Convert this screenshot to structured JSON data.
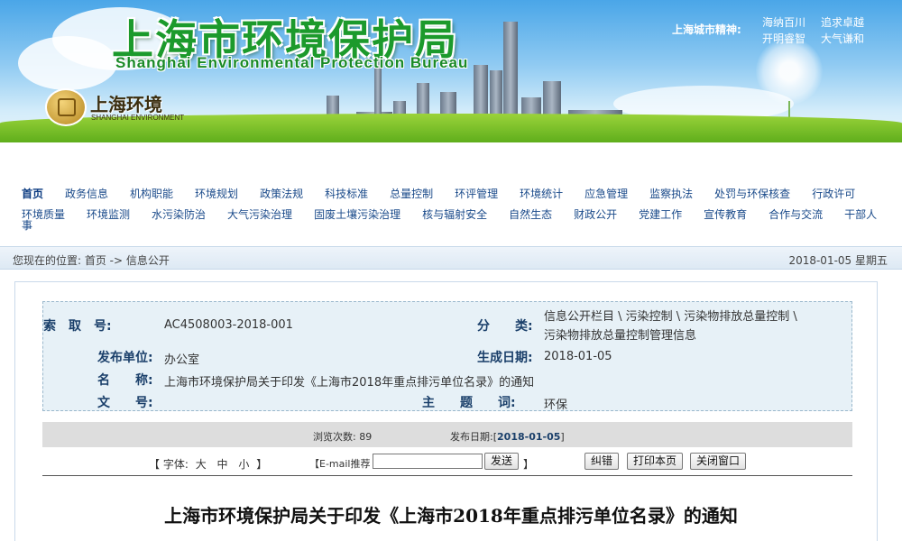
{
  "header": {
    "title_cn": "上海市环境保护局",
    "title_en": "Shanghai Environmental Protection Bureau",
    "logo_cn": "上海环境",
    "logo_en": "SHANGHAI ENVIRONMENT",
    "spirit_label": "上海城市精神:",
    "spirit_words": [
      "海纳百川",
      "追求卓越",
      "开明睿智",
      "大气谦和"
    ]
  },
  "nav": {
    "row1": [
      "首页",
      "政务信息",
      "机构职能",
      "环境规划",
      "政策法规",
      "科技标准",
      "总量控制",
      "环评管理",
      "环境统计",
      "应急管理",
      "监察执法",
      "处罚与环保核查",
      "行政许可"
    ],
    "row2": [
      "环境质量",
      "环境监测",
      "水污染防治",
      "大气污染治理",
      "固废土壤污染治理",
      "核与辐射安全",
      "自然生态",
      "财政公开",
      "党建工作",
      "宣传教育",
      "合作与交流",
      "干部人"
    ],
    "wrap_text": "事"
  },
  "breadcrumb": {
    "text": "您现在的位置: 首页 -> 信息公开",
    "date": "2018-01-05  星期五"
  },
  "info": {
    "index_label": "索　取　号:",
    "index_value": "AC4508003-2018-001",
    "category_label": "分　　类:",
    "category_line1": "信息公开栏目 \\ 污染控制 \\ 污染物排放总量控制 \\",
    "category_line2": "污染物排放总量控制管理信息",
    "publisher_label": "发布单位:",
    "publisher_value": "办公室",
    "created_label": "生成日期:",
    "created_value": "2018-01-05",
    "name_label": "名　　称:",
    "name_value": "上海市环境保护局关于印发《上海市2018年重点排污单位名录》的通知",
    "docno_label": "文　　号:",
    "docno_value": "",
    "topic_label": "主　　题　　词:",
    "topic_value": "环保"
  },
  "stats": {
    "views_label": "浏览次数:",
    "views_value": "89",
    "publish_label": "发布日期:",
    "publish_value": "2018-01-05"
  },
  "tools": {
    "font_prefix": "【 字体:",
    "font_large": "大",
    "font_medium": "中",
    "font_small": "小",
    "font_suffix": "】",
    "email_label": "【E-mail推荐",
    "email_value": "",
    "send_label": "发送",
    "email_suffix": "】",
    "correct_label": "纠错",
    "print_label": "打印本页",
    "close_label": "关闭窗口"
  },
  "document": {
    "title": "上海市环境保护局关于印发《上海市2018年重点排污单位名录》的通知"
  }
}
